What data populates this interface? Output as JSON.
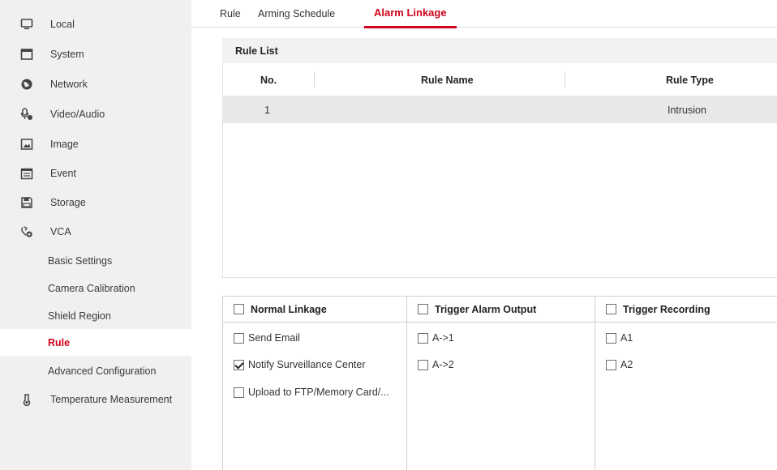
{
  "sidebar": {
    "items": [
      {
        "label": "Local",
        "icon": "monitor-icon"
      },
      {
        "label": "System",
        "icon": "window-icon"
      },
      {
        "label": "Network",
        "icon": "globe-icon"
      },
      {
        "label": "Video/Audio",
        "icon": "audio-video-icon"
      },
      {
        "label": "Image",
        "icon": "image-icon"
      },
      {
        "label": "Event",
        "icon": "calendar-icon"
      },
      {
        "label": "Storage",
        "icon": "storage-icon"
      },
      {
        "label": "VCA",
        "icon": "vca-icon"
      }
    ],
    "vca_sub": [
      "Basic Settings",
      "Camera Calibration",
      "Shield Region",
      "Rule",
      "Advanced Configuration"
    ],
    "active_sub": "Rule",
    "temperature": {
      "label": "Temperature Measurement",
      "icon": "thermometer-icon"
    }
  },
  "tabs": [
    "Rule",
    "Arming Schedule",
    "Alarm Linkage"
  ],
  "active_tab": "Alarm Linkage",
  "rule_list": {
    "title": "Rule List",
    "columns": [
      "No.",
      "Rule Name",
      "Rule Type"
    ],
    "rows": [
      {
        "no": "1",
        "name": "",
        "type": "Intrusion"
      }
    ]
  },
  "linkage": {
    "normal": {
      "title": "Normal Linkage",
      "checked": false,
      "options": [
        {
          "label": "Send Email",
          "checked": false
        },
        {
          "label": "Notify Surveillance Center",
          "checked": true
        },
        {
          "label": "Upload to FTP/Memory Card/...",
          "checked": false
        }
      ]
    },
    "alarm_output": {
      "title": "Trigger Alarm Output",
      "checked": false,
      "options": [
        {
          "label": "A->1",
          "checked": false
        },
        {
          "label": "A->2",
          "checked": false
        }
      ]
    },
    "recording": {
      "title": "Trigger Recording",
      "checked": false,
      "options": [
        {
          "label": "A1",
          "checked": false
        },
        {
          "label": "A2",
          "checked": false
        }
      ]
    }
  },
  "colors": {
    "accent": "#d0021b",
    "sidebar_bg": "#f0f0f0",
    "selected_row": "#e8e8e8"
  }
}
